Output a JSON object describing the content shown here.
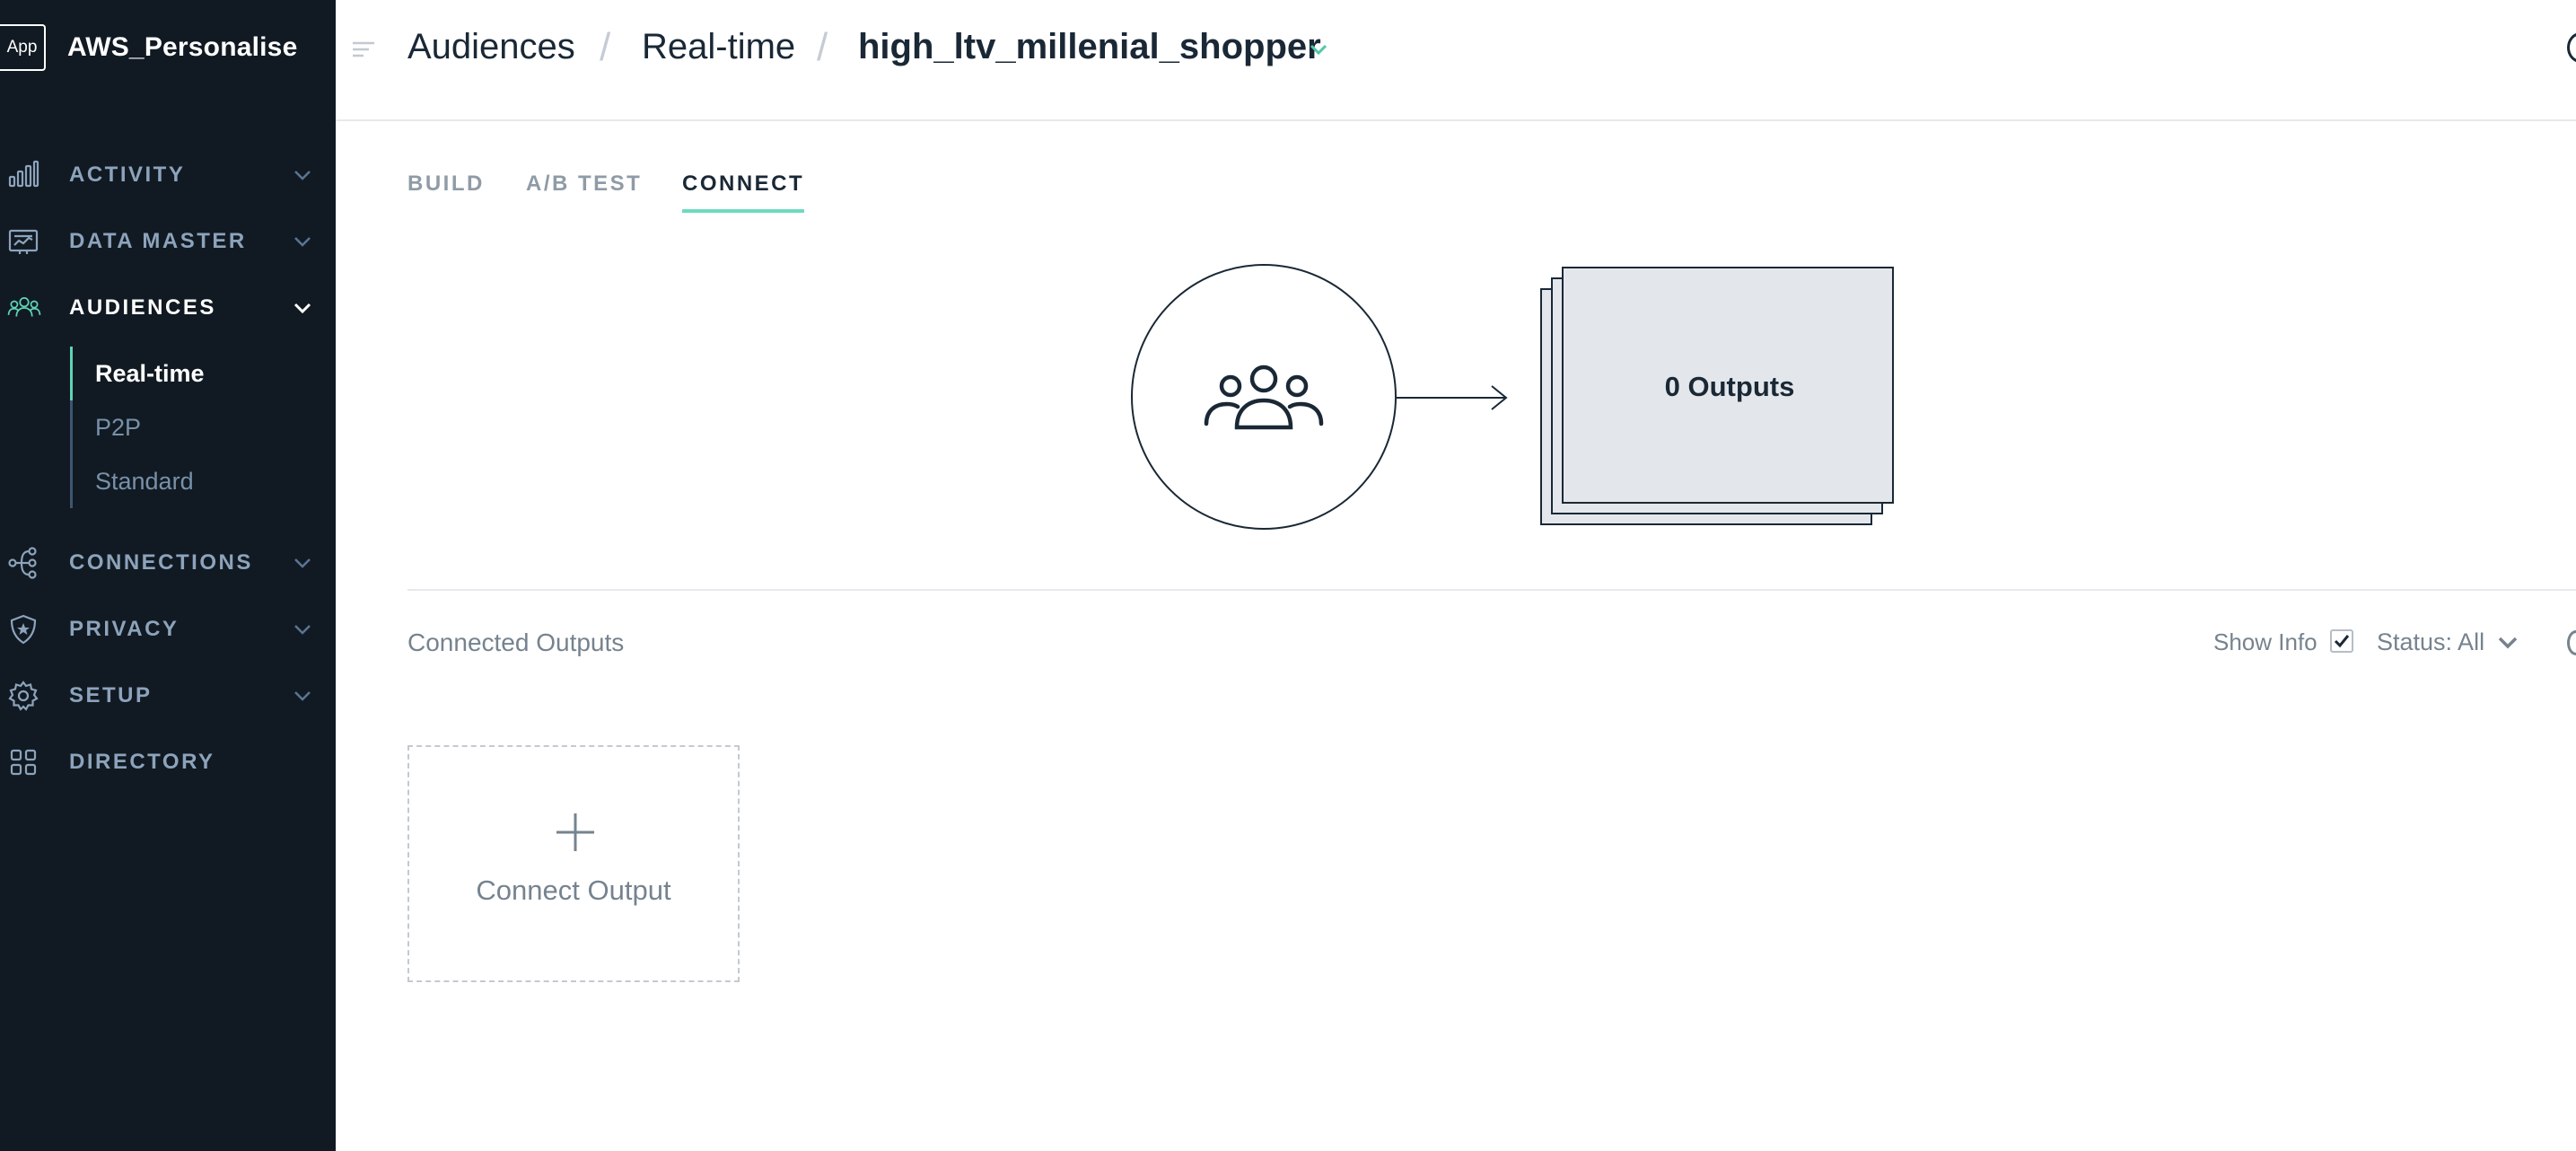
{
  "app": {
    "logo_text": "App",
    "name": "AWS_Personalise"
  },
  "sidebar": {
    "items": [
      {
        "label": "ACTIVITY",
        "icon": "bar-chart-icon",
        "expandable": true
      },
      {
        "label": "DATA MASTER",
        "icon": "data-board-icon",
        "expandable": true
      },
      {
        "label": "AUDIENCES",
        "icon": "users-icon",
        "expandable": true,
        "expanded": true,
        "active": true
      },
      {
        "label": "CONNECTIONS",
        "icon": "connections-icon",
        "expandable": true
      },
      {
        "label": "PRIVACY",
        "icon": "shield-star-icon",
        "expandable": true
      },
      {
        "label": "SETUP",
        "icon": "gear-icon",
        "expandable": true
      },
      {
        "label": "DIRECTORY",
        "icon": "grid-icon",
        "expandable": false
      }
    ],
    "audiences_subitems": [
      {
        "label": "Real-time",
        "active": true
      },
      {
        "label": "P2P",
        "active": false
      },
      {
        "label": "Standard",
        "active": false
      }
    ]
  },
  "header": {
    "breadcrumb": [
      "Audiences",
      "Real-time",
      "high_ltv_millenial_shopper"
    ],
    "separator": "/"
  },
  "tabs": [
    {
      "label": "BUILD",
      "active": false
    },
    {
      "label": "A/B TEST",
      "active": false
    },
    {
      "label": "CONNECT",
      "active": true
    }
  ],
  "flow": {
    "source_icon": "audience-group-icon",
    "outputs_label": "0 Outputs"
  },
  "connected_outputs": {
    "title": "Connected Outputs",
    "show_info_label": "Show Info",
    "show_info_checked": true,
    "status_filter": "Status: All",
    "connect_output_label": "Connect Output"
  },
  "colors": {
    "sidebar_bg": "#111a22",
    "accent": "#5fd4b6",
    "text_dark": "#1a2836",
    "text_muted": "#76838f",
    "nav_muted": "#8da3bc",
    "output_card_bg": "#e3e7eb"
  }
}
